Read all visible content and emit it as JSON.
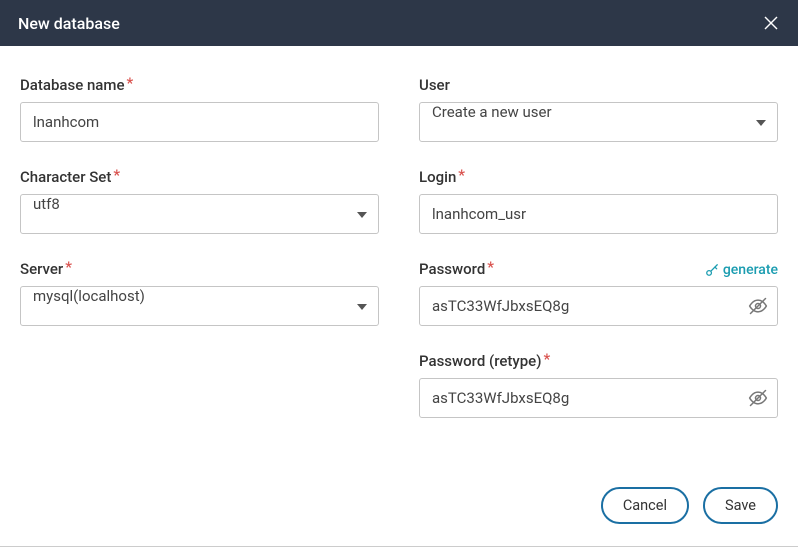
{
  "header": {
    "title": "New database"
  },
  "labels": {
    "database_name": "Database name",
    "character_set": "Character Set",
    "server": "Server",
    "user": "User",
    "login": "Login",
    "password": "Password",
    "password_retype": "Password (retype)",
    "generate": "generate"
  },
  "values": {
    "database_name": "lnanhcom",
    "character_set": "utf8",
    "server": "mysql(localhost)",
    "user": "Create a new user",
    "login": "lnanhcom_usr",
    "password": "asTC33WfJbxsEQ8g",
    "password_retype": "asTC33WfJbxsEQ8g"
  },
  "buttons": {
    "cancel": "Cancel",
    "save": "Save"
  },
  "icons": {
    "close": "close-icon",
    "caret": "caret-down-icon",
    "eye": "eye-hidden-icon",
    "key": "key-icon"
  }
}
